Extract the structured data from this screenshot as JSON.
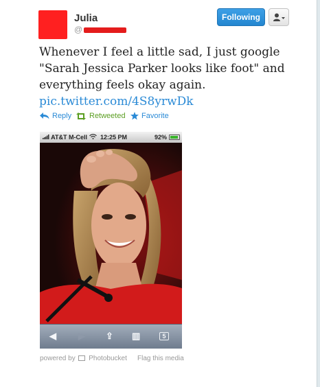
{
  "header": {
    "name": "Julia",
    "handle_prefix": "@",
    "follow_label": "Following",
    "user_menu_icon": "user-dropdown-icon",
    "avatar_color": "#ff2020"
  },
  "tweet": {
    "text": "Whenever I feel a little sad, I just google \"Sarah Jessica Parker looks like foot\" and everything feels okay again.",
    "link": "pic.twitter.com/4S8yrwDk"
  },
  "actions": {
    "reply": "Reply",
    "retweeted": "Retweeted",
    "favorite": "Favorite",
    "accent": "#2a8ad6",
    "retweet_color": "#5b9e22"
  },
  "phone": {
    "carrier": "AT&T M-Cell",
    "time": "12:25 PM",
    "battery": "92%",
    "tab_count": "5"
  },
  "footer": {
    "powered_prefix": "powered by",
    "powered_brand": "Photobucket",
    "flag": "Flag this media"
  }
}
